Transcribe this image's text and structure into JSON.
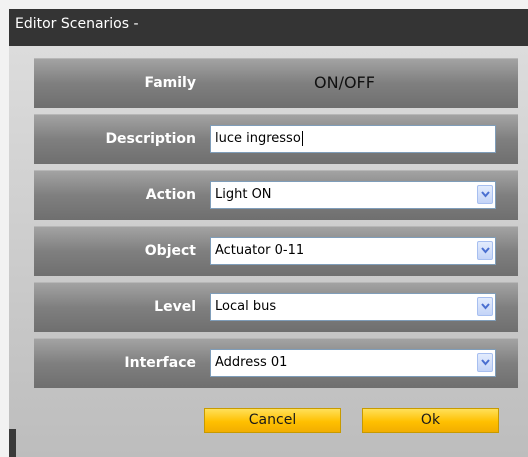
{
  "window": {
    "title": "Editor Scenarios -"
  },
  "form": {
    "family": {
      "label": "Family",
      "value": "ON/OFF"
    },
    "description": {
      "label": "Description",
      "value": "luce ingresso"
    },
    "action": {
      "label": "Action",
      "selected": "Light ON"
    },
    "object": {
      "label": "Object",
      "selected": "Actuator 0-11"
    },
    "level": {
      "label": "Level",
      "selected": "Local bus"
    },
    "interface": {
      "label": "Interface",
      "selected": "Address 01"
    }
  },
  "buttons": {
    "cancel_label": "Cancel",
    "ok_label": "Ok"
  },
  "colors": {
    "titlebar": "#343434",
    "row": "#8a8a8a",
    "button": "#ffc000",
    "dropdown_arrow": "#4a6fd0"
  },
  "icons": {
    "dropdown": "chevron-down-icon"
  }
}
